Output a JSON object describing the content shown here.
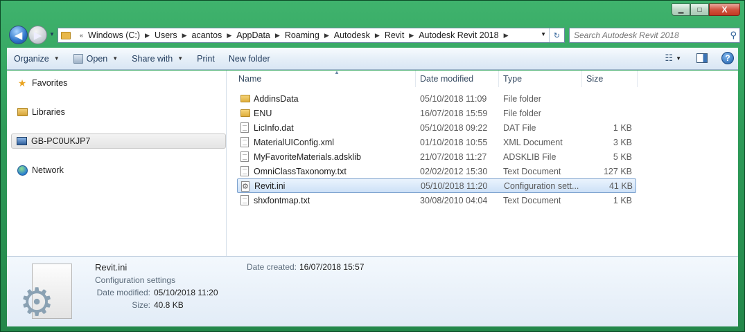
{
  "window": {
    "minimize_glyph": "▁",
    "maximize_glyph": "□",
    "close_glyph": "X"
  },
  "nav": {
    "back_glyph": "◀",
    "forward_glyph": "▶",
    "breadcrumbs": [
      "Windows (C:)",
      "Users",
      "acantos",
      "AppData",
      "Roaming",
      "Autodesk",
      "Revit",
      "Autodesk Revit 2018"
    ],
    "search_placeholder": "Search Autodesk Revit 2018"
  },
  "toolbar": {
    "organize": "Organize",
    "open": "Open",
    "share_with": "Share with",
    "print": "Print",
    "new_folder": "New folder"
  },
  "navpane": {
    "favorites": "Favorites",
    "libraries": "Libraries",
    "computer": "GB-PC0UKJP7",
    "network": "Network"
  },
  "columns": {
    "name": "Name",
    "date": "Date modified",
    "type": "Type",
    "size": "Size"
  },
  "files": [
    {
      "name": "AddinsData",
      "date": "05/10/2018 11:09",
      "type": "File folder",
      "size": "",
      "icon": "folder-icon"
    },
    {
      "name": "ENU",
      "date": "16/07/2018 15:59",
      "type": "File folder",
      "size": "",
      "icon": "folder-icon"
    },
    {
      "name": "LicInfo.dat",
      "date": "05/10/2018 09:22",
      "type": "DAT File",
      "size": "1 KB",
      "icon": "file-icon"
    },
    {
      "name": "MaterialUIConfig.xml",
      "date": "01/10/2018 10:55",
      "type": "XML Document",
      "size": "3 KB",
      "icon": "file-icon"
    },
    {
      "name": "MyFavoriteMaterials.adsklib",
      "date": "21/07/2018 11:27",
      "type": "ADSKLIB File",
      "size": "5 KB",
      "icon": "file-icon"
    },
    {
      "name": "OmniClassTaxonomy.txt",
      "date": "02/02/2012 15:30",
      "type": "Text Document",
      "size": "127 KB",
      "icon": "text-file-icon"
    },
    {
      "name": "Revit.ini",
      "date": "05/10/2018 11:20",
      "type": "Configuration sett...",
      "size": "41 KB",
      "icon": "config-file-icon"
    },
    {
      "name": "shxfontmap.txt",
      "date": "30/08/2010 04:04",
      "type": "Text Document",
      "size": "1 KB",
      "icon": "text-file-icon"
    }
  ],
  "details": {
    "name": "Revit.ini",
    "type": "Configuration settings",
    "modified_label": "Date modified:",
    "modified": "05/10/2018 11:20",
    "size_label": "Size:",
    "size": "40.8 KB",
    "created_label": "Date created:",
    "created": "16/07/2018 15:57"
  }
}
